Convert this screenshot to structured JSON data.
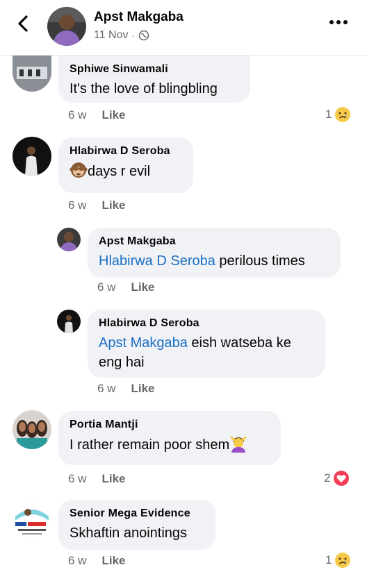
{
  "header": {
    "name": "Apst Makgaba",
    "date": "11 Nov",
    "dot": "·",
    "privacy_icon": "globe-icon"
  },
  "comments": [
    {
      "name": "Sphiwe Sinwamali",
      "text": "It's the love of blingbling",
      "time": "6 w",
      "like": "Like",
      "reaction_count": "1",
      "reaction_icon": "sad-face-emoji"
    },
    {
      "name": "Hlabirwa D Seroba",
      "text": "days r evil",
      "emoji": "monkey-emoji",
      "time": "6 w",
      "like": "Like"
    },
    {
      "name": "Apst Makgaba",
      "mention": "Hlabirwa D Seroba",
      "text": " perilous times",
      "time": "6 w",
      "like": "Like"
    },
    {
      "name": "Hlabirwa D Seroba",
      "mention": "Apst Makgaba",
      "text": " eish watseba ke",
      "text2": "eng hai",
      "time": "6 w",
      "like": "Like"
    },
    {
      "name": "Portia Mantji",
      "text": "I rather remain poor shem",
      "emoji": "woman-gesturing-emoji",
      "time": "6 w",
      "like": "Like",
      "reaction_count": "2",
      "reaction_icon": "heart-emoji"
    },
    {
      "name": "Senior Mega Evidence",
      "text": "Skhaftin anointings",
      "time": "6 w",
      "like": "Like",
      "reaction_count": "1",
      "reaction_icon": "sad-face-emoji"
    }
  ],
  "colors": {
    "mention": "#1b6ec2",
    "meta": "#65676b",
    "bubble": "#f0f2f5",
    "heart": "#f33e58",
    "emoji_yellow": "#f7c948"
  }
}
